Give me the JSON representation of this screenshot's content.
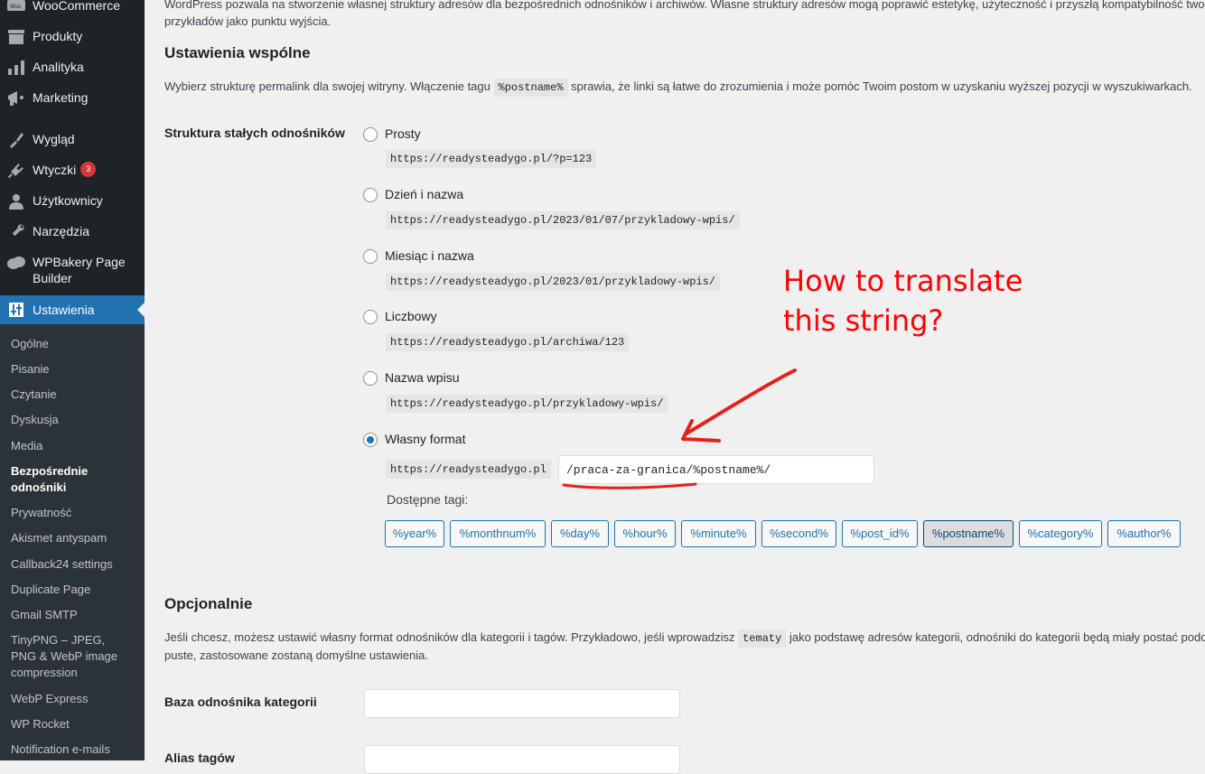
{
  "sidebar": {
    "menu": [
      {
        "label": "WooCommerce",
        "icon": "woocommerce-icon"
      },
      {
        "label": "Produkty",
        "icon": "products-icon"
      },
      {
        "label": "Analityka",
        "icon": "analytics-icon"
      },
      {
        "label": "Marketing",
        "icon": "marketing-icon"
      },
      {
        "label": "Wygląd",
        "icon": "appearance-icon"
      },
      {
        "label": "Wtyczki",
        "icon": "plugins-icon",
        "badge": "3"
      },
      {
        "label": "Użytkownicy",
        "icon": "users-icon"
      },
      {
        "label": "Narzędzia",
        "icon": "tools-icon"
      },
      {
        "label": "WPBakery Page Builder",
        "icon": "wpbakery-icon"
      },
      {
        "label": "Ustawienia",
        "icon": "settings-icon",
        "current": true
      }
    ],
    "submenu": [
      "Ogólne",
      "Pisanie",
      "Czytanie",
      "Dyskusja",
      "Media",
      "Bezpośrednie odnośniki",
      "Prywatność",
      "Akismet antyspam",
      "Callback24 settings",
      "Duplicate Page",
      "Gmail SMTP",
      "TinyPNG – JPEG, PNG & WebP image compression",
      "WebP Express",
      "WP Rocket",
      "Notification e-mails"
    ],
    "active_submenu": "Bezpośrednie odnośniki"
  },
  "intro": {
    "line1": "WordPress pozwala na stworzenie własnej struktury adresów dla bezpośrednich odnośników i archiwów. Własne struktury adresów mogą poprawić estetykę, użyteczność i przyszłą kompatybilność twoich",
    "line2": "przykładów jako punktu wyjścia."
  },
  "common": {
    "title": "Ustawienia wspólne",
    "desc_before": "Wybierz strukturę permalink dla swojej witryny. Włączenie tagu",
    "desc_code": "%postname%",
    "desc_after": "sprawia, że linki są łatwe do zrozumienia i może pomóc Twoim postom w uzyskaniu wyższej pozycji w wyszukiwarkach.",
    "structure_label": "Struktura stałych odnośników",
    "options": [
      {
        "label": "Prosty",
        "example": "https://readysteadygo.pl/?p=123",
        "checked": false
      },
      {
        "label": "Dzień i nazwa",
        "example": "https://readysteadygo.pl/2023/01/07/przykladowy-wpis/",
        "checked": false
      },
      {
        "label": "Miesiąc i nazwa",
        "example": "https://readysteadygo.pl/2023/01/przykladowy-wpis/",
        "checked": false
      },
      {
        "label": "Liczbowy",
        "example": "https://readysteadygo.pl/archiwa/123",
        "checked": false
      },
      {
        "label": "Nazwa wpisu",
        "example": "https://readysteadygo.pl/przykladowy-wpis/",
        "checked": false
      }
    ],
    "custom": {
      "label": "Własny format",
      "checked": true,
      "prefix": "https://readysteadygo.pl",
      "value": "/praca-za-granica/%postname%/"
    },
    "available_tags_label": "Dostępne tagi:",
    "tags": [
      "%year%",
      "%monthnum%",
      "%day%",
      "%hour%",
      "%minute%",
      "%second%",
      "%post_id%",
      "%postname%",
      "%category%",
      "%author%"
    ],
    "active_tag": "%postname%"
  },
  "optional": {
    "title": "Opcjonalnie",
    "desc1_before": "Jeśli chcesz, możesz ustawić własny format odnośników dla kategorii i tagów. Przykładowo, jeśli wprowadzisz",
    "desc1_code": "tematy",
    "desc1_after": "jako podstawę adresów kategorii, odnośniki do kategorii będą miały postać podob",
    "desc2": "puste, zastosowane zostaną domyślne ustawienia.",
    "category_base_label": "Baza odnośnika kategorii",
    "category_base_value": "",
    "tag_base_label": "Alias tagów",
    "tag_base_value": ""
  },
  "annotation": {
    "line1": "How to translate",
    "line2": "this string?",
    "color": "#ff0000"
  }
}
